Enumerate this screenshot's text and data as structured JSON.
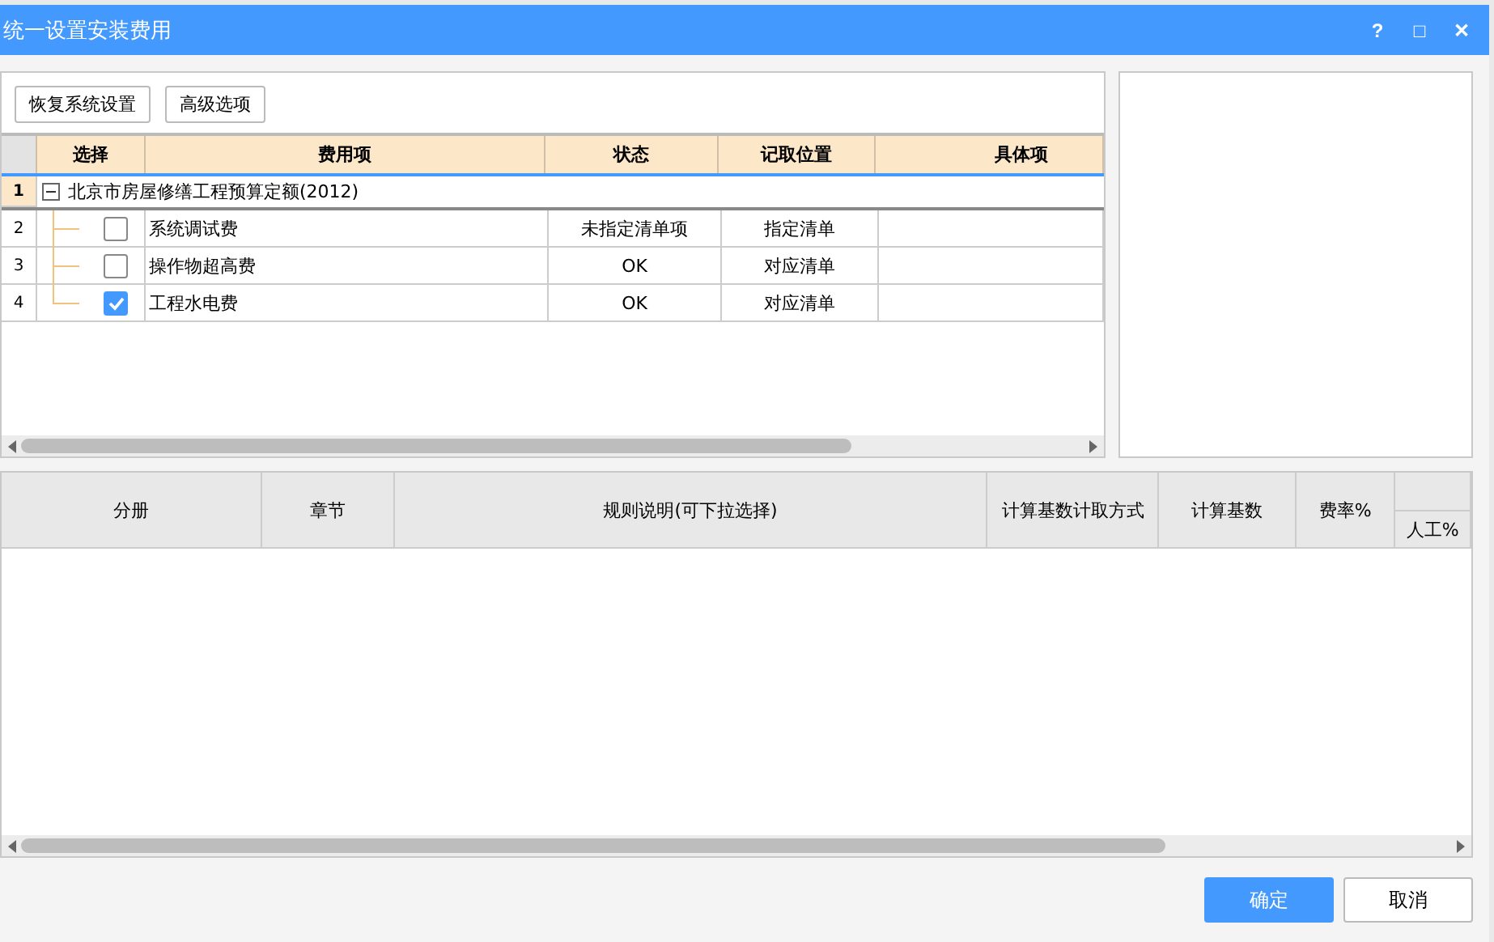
{
  "window": {
    "title": "统一设置安装费用",
    "controls": [
      "?",
      "□",
      "✕"
    ]
  },
  "toolbar": {
    "buttons": [
      "恢复系统设置",
      "高级选项"
    ]
  },
  "table": {
    "columns": [
      "选择",
      "费用项",
      "状态",
      "记取位置",
      "具体项"
    ],
    "rows": [
      {
        "number": "1",
        "label": "北京市房屋修缮工程预算定额(2012)",
        "expanded": true,
        "selected": true,
        "children": [
          {
            "number": "2",
            "checked": false,
            "name": "系统调试费",
            "status": "未指定清单项",
            "location": "指定清单"
          },
          {
            "number": "3",
            "checked": false,
            "name": "操作物超高费",
            "status": "OK",
            "location": "对应清单"
          },
          {
            "number": "4",
            "checked": true,
            "name": "工程水电费",
            "status": "OK",
            "location": "对应清单"
          }
        ]
      }
    ]
  },
  "rules_table": {
    "columns": [
      "分册",
      "章节",
      "规则说明(可下拉选择)",
      "计算基数计取方式",
      "计算基数",
      "费率%"
    ],
    "subcolumn": "人工%"
  },
  "buttons": [
    {
      "label": "确定",
      "kind": "primary"
    },
    {
      "label": "取消",
      "kind": "secondary"
    }
  ]
}
